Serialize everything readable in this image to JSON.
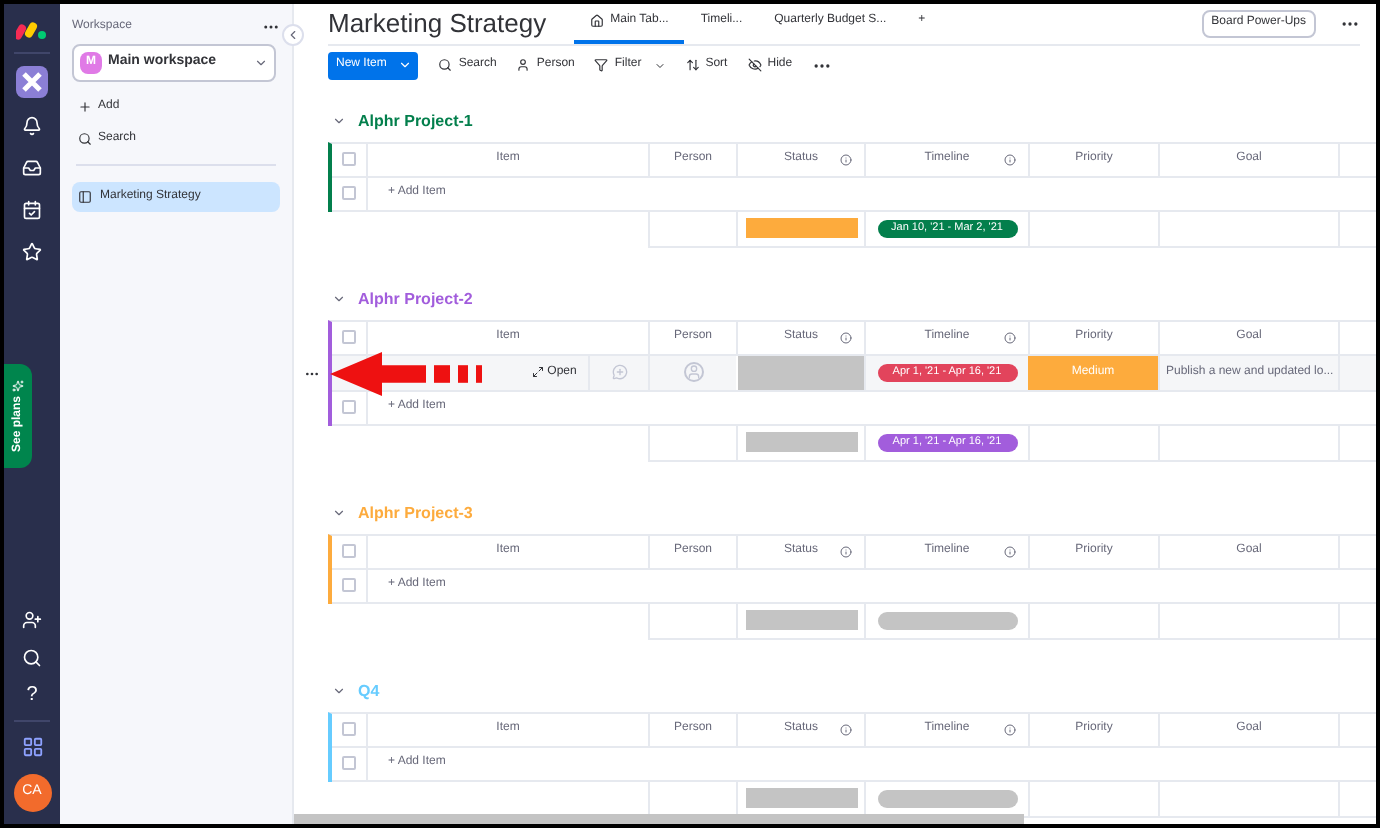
{
  "nav": {
    "help": "?",
    "avatar": "CA",
    "see_plans": "See plans"
  },
  "workspace": {
    "label": "Workspace",
    "badge": "M",
    "name": "Main workspace",
    "actions": [
      {
        "label": "Add",
        "kind": "add"
      },
      {
        "label": "Search",
        "kind": "search"
      }
    ],
    "boards": [
      {
        "label": "Marketing Strategy",
        "selected": true
      }
    ]
  },
  "board": {
    "title": "Marketing Strategy",
    "tabs": [
      {
        "label": "Main Tab...",
        "selected": true,
        "kind": "home"
      },
      {
        "label": "Timeli...",
        "selected": false,
        "kind": "plain"
      },
      {
        "label": "Quarterly Budget S...",
        "selected": false,
        "kind": "plain"
      },
      {
        "label": "+",
        "selected": false,
        "kind": "plain"
      }
    ],
    "power_ups": "Board Power-Ups"
  },
  "toolbar": {
    "new_item": "New Item",
    "tools": [
      {
        "label": "Search",
        "kind": "search"
      },
      {
        "label": "Person",
        "kind": "person"
      },
      {
        "label": "Filter",
        "kind": "filter"
      },
      {
        "label": "Sort",
        "kind": "sort"
      },
      {
        "label": "Hide",
        "kind": "hide"
      }
    ]
  },
  "groups": [
    {
      "title": "Alphr Project-1",
      "color": "#037f4c",
      "header_checked": false,
      "columns": [
        {
          "label": "Item",
          "info": false
        },
        {
          "label": "Person",
          "info": false
        },
        {
          "label": "Status",
          "info": true
        },
        {
          "label": "Timeline",
          "info": true
        },
        {
          "label": "Priority",
          "info": false
        },
        {
          "label": "Goal",
          "info": false
        }
      ],
      "add_item": {
        "label": "+ Add Item",
        "checked": false
      },
      "summary": {
        "status": {
          "color": "#fdab3d"
        },
        "timeline": {
          "label": "Jan 10, '21 - Mar 2, '21",
          "color": "#037f4c"
        }
      }
    },
    {
      "title": "Alphr Project-2",
      "color": "#a25ddc",
      "header_checked": false,
      "columns": [
        {
          "label": "Item",
          "info": false
        },
        {
          "label": "Person",
          "info": false
        },
        {
          "label": "Status",
          "info": true
        },
        {
          "label": "Timeline",
          "info": true
        },
        {
          "label": "Priority",
          "info": false
        },
        {
          "label": "Goal",
          "info": false
        }
      ],
      "items": [
        {
          "open": "Open",
          "timeline": {
            "label": "Apr 1, '21 - Apr 16, '21",
            "color": "#e2445c"
          },
          "priority": {
            "label": "Medium",
            "color": "#fdab3d"
          },
          "goal": "Publish a new and updated lo..."
        }
      ],
      "add_item": {
        "label": "+ Add Item",
        "checked": false
      },
      "summary": {
        "status": {
          "color": "#c4c4c4"
        },
        "timeline": {
          "label": "Apr 1, '21 - Apr 16, '21",
          "color": "#a25ddc"
        }
      }
    },
    {
      "title": "Alphr Project-3",
      "color": "#fdab3d",
      "header_checked": false,
      "columns": [
        {
          "label": "Item",
          "info": false
        },
        {
          "label": "Person",
          "info": false
        },
        {
          "label": "Status",
          "info": true
        },
        {
          "label": "Timeline",
          "info": true
        },
        {
          "label": "Priority",
          "info": false
        },
        {
          "label": "Goal",
          "info": false
        }
      ],
      "add_item": {
        "label": "+ Add Item",
        "checked": false
      },
      "summary": {
        "status": {
          "color": "#c4c4c4"
        },
        "timeline": {
          "color": "#c4c4c4"
        }
      }
    },
    {
      "title": "Q4",
      "color": "#66ccff",
      "header_checked": false,
      "columns": [
        {
          "label": "Item",
          "info": false
        },
        {
          "label": "Person",
          "info": false
        },
        {
          "label": "Status",
          "info": true
        },
        {
          "label": "Timeline",
          "info": true
        },
        {
          "label": "Priority",
          "info": false
        },
        {
          "label": "Goal",
          "info": false
        }
      ],
      "add_item": {
        "label": "+ Add Item",
        "checked": false
      },
      "summary": {
        "status": {
          "color": "#c4c4c4"
        },
        "timeline": {
          "color": "#c4c4c4"
        }
      }
    }
  ]
}
